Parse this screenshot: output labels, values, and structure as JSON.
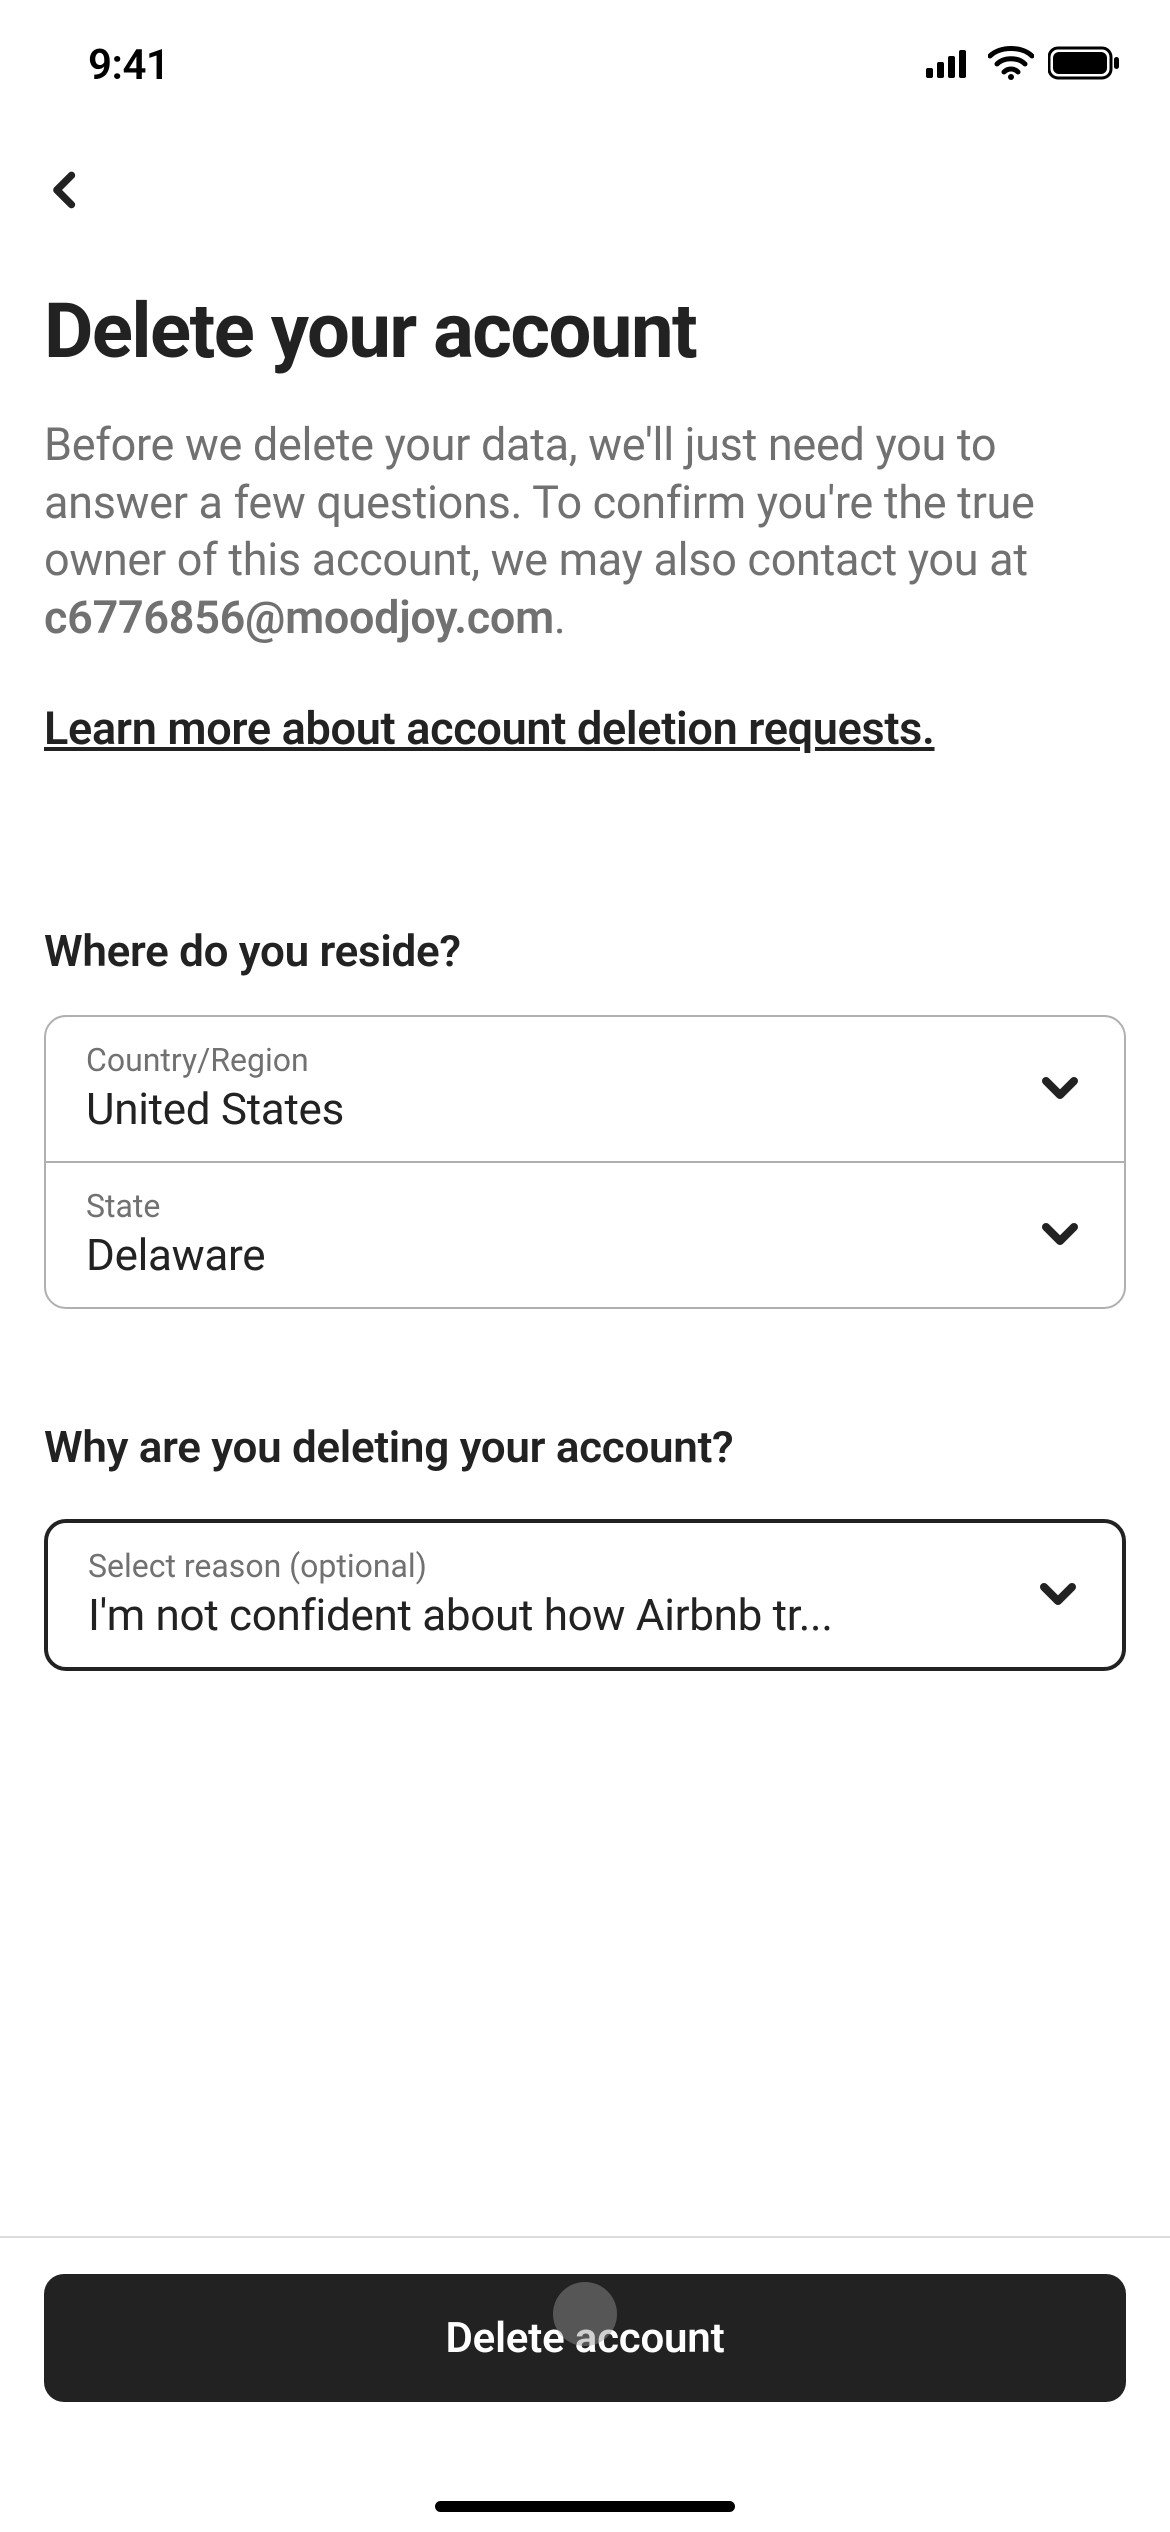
{
  "status_bar": {
    "time": "9:41"
  },
  "header": {
    "title": "Delete your account",
    "description_prefix": "Before we delete your data, we'll just need you to answer a few questions. To confirm you're the true owner of this account, we may also contact you at ",
    "email": "c6776856@moodjoy.com",
    "description_suffix": ".",
    "learn_more": "Learn more about account deletion requests."
  },
  "form": {
    "reside": {
      "question": "Where do you reside?",
      "country_label": "Country/Region",
      "country_value": "United States",
      "state_label": "State",
      "state_value": "Delaware"
    },
    "reason": {
      "question": "Why are you deleting your account?",
      "select_label": "Select reason (optional)",
      "select_value": "I'm not confident about how Airbnb tr..."
    }
  },
  "footer": {
    "primary_button": "Delete account"
  }
}
